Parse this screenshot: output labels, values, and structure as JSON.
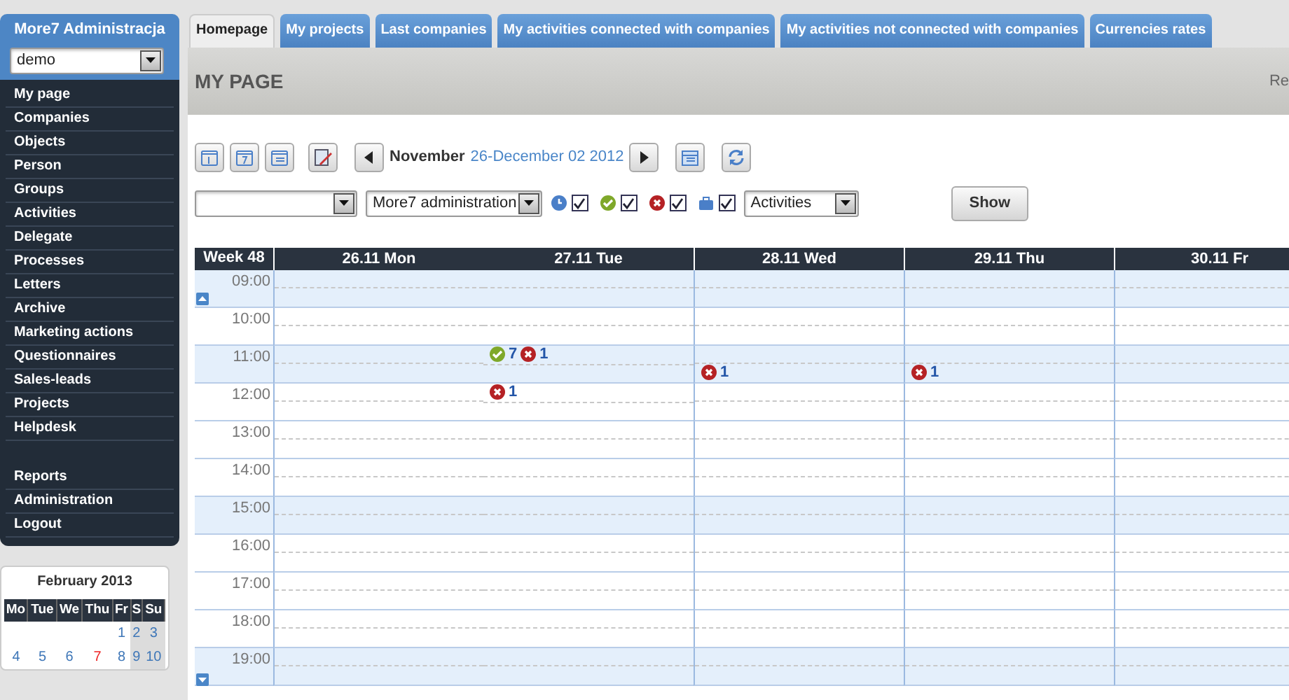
{
  "sidebar": {
    "title": "More7 Administracja",
    "user_select": "demo",
    "menu": [
      {
        "label": "My page"
      },
      {
        "label": "Companies"
      },
      {
        "label": "Objects"
      },
      {
        "label": "Person"
      },
      {
        "label": "Groups"
      },
      {
        "label": "Activities"
      },
      {
        "label": "Delegate"
      },
      {
        "label": "Processes"
      },
      {
        "label": "Letters"
      },
      {
        "label": "Archive"
      },
      {
        "label": "Marketing actions"
      },
      {
        "label": "Questionnaires"
      },
      {
        "label": "Sales-leads"
      },
      {
        "label": "Projects"
      },
      {
        "label": "Helpdesk"
      }
    ],
    "menu_bottom": [
      {
        "label": "Reports"
      },
      {
        "label": "Administration"
      },
      {
        "label": "Logout"
      }
    ],
    "mini_calendar": {
      "title": "February 2013",
      "weekdays": [
        "Mo",
        "Tue",
        "We",
        "Thu",
        "Fr",
        "S",
        "Su"
      ],
      "weeks": [
        [
          {
            "text": "1",
            "holiday": false
          },
          {
            "text": "2",
            "holiday": false
          },
          {
            "text": "3",
            "holiday": false
          }
        ],
        [
          {
            "text": "4",
            "holiday": false
          },
          {
            "text": "5",
            "holiday": false
          },
          {
            "text": "6",
            "holiday": false
          },
          {
            "text": "7",
            "holiday": true
          },
          {
            "text": "8",
            "holiday": false
          },
          {
            "text": "9",
            "holiday": false
          },
          {
            "text": "10",
            "holiday": false
          }
        ]
      ]
    }
  },
  "tabs": [
    {
      "label": "Homepage",
      "selected": true
    },
    {
      "label": "My projects",
      "selected": false
    },
    {
      "label": "Last companies",
      "selected": false
    },
    {
      "label": "My activities connected with companies",
      "selected": false
    },
    {
      "label": "My activities not connected with companies",
      "selected": false
    },
    {
      "label": "Currencies rates",
      "selected": false
    }
  ],
  "page_title": "MY PAGE",
  "header_right": "Re",
  "toolbar": {
    "month": "November",
    "range": "26-December 02 2012"
  },
  "filters": {
    "select_2": "More7 administration",
    "checkboxes": [
      {
        "kind": "planned",
        "checked": true
      },
      {
        "kind": "done",
        "checked": true
      },
      {
        "kind": "cancelled",
        "checked": true
      },
      {
        "kind": "work",
        "checked": true
      }
    ],
    "select_3": "Activities",
    "show_button": "Show"
  },
  "calendar": {
    "week": "Week 48",
    "days": [
      "26.11 Mon",
      "27.11 Tue",
      "28.11 Wed",
      "29.11 Thu",
      "30.11 Fr"
    ],
    "hours": [
      {
        "label": "09:00",
        "shaded": true
      },
      {
        "label": "10:00",
        "shaded": false
      },
      {
        "label": "11:00",
        "shaded": true,
        "halves": [
          {
            "cells": [
              {},
              {
                "events": [
                  {
                    "kind": "done",
                    "count": "7"
                  },
                  {
                    "kind": "cancelled",
                    "count": "1"
                  }
                ]
              },
              {},
              {},
              {}
            ]
          },
          {
            "cells": [
              {},
              {},
              {
                "events": [
                  {
                    "kind": "cancelled",
                    "count": "1"
                  }
                ]
              },
              {
                "events": [
                  {
                    "kind": "cancelled",
                    "count": "1"
                  }
                ]
              },
              {}
            ]
          }
        ]
      },
      {
        "label": "12:00",
        "shaded": false,
        "halves": [
          {
            "cells": [
              {},
              {
                "events": [
                  {
                    "kind": "cancelled",
                    "count": "1"
                  }
                ]
              },
              {},
              {},
              {}
            ]
          },
          {
            "cells": [
              {},
              {},
              {},
              {},
              {}
            ]
          }
        ]
      },
      {
        "label": "13:00",
        "shaded": false
      },
      {
        "label": "14:00",
        "shaded": false
      },
      {
        "label": "15:00",
        "shaded": true
      },
      {
        "label": "16:00",
        "shaded": false
      },
      {
        "label": "17:00",
        "shaded": false
      },
      {
        "label": "18:00",
        "shaded": false
      },
      {
        "label": "19:00",
        "shaded": true
      }
    ]
  }
}
